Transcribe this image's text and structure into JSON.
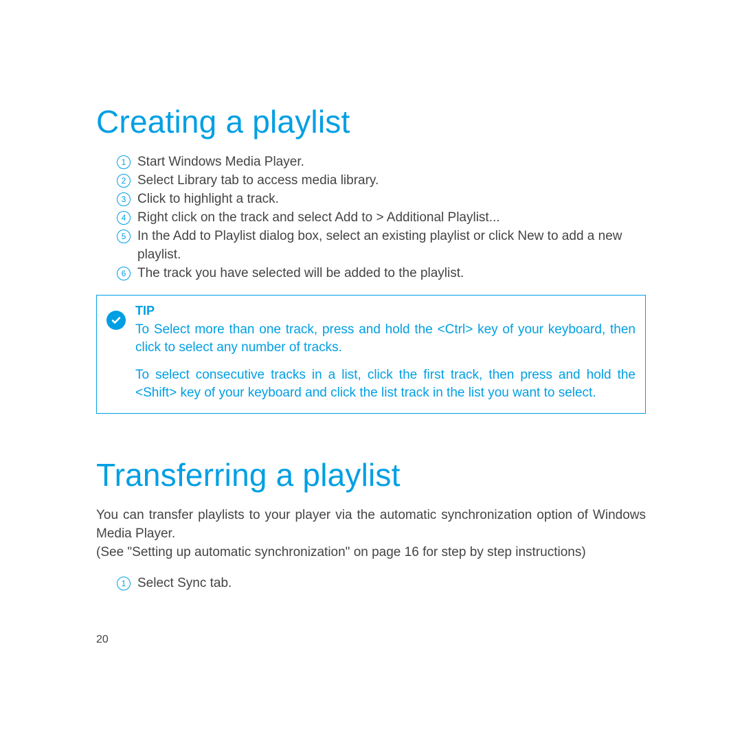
{
  "accent_color": "#009FE3",
  "section1": {
    "title": "Creating a playlist",
    "steps": [
      "Start Windows Media Player.",
      "Select Library tab to access media library.",
      "Click to highlight a track.",
      "Right click on the track and select Add to > Additional Playlist...",
      "In the Add to Playlist dialog box, select an existing playlist or click New to add a new playlist.",
      "The track you have selected will be added to the playlist."
    ],
    "tip": {
      "label": "TIP",
      "paragraphs": [
        "To Select more than one track, press and hold the <Ctrl> key of your keyboard, then click to select any number of tracks.",
        "To select consecutive tracks in a list, click the first track, then press and hold the <Shift> key of your keyboard and click the list track in the list you want to select."
      ]
    }
  },
  "section2": {
    "title": "Transferring a playlist",
    "intro_lines": [
      "You can transfer playlists to your player via the automatic synchronization option of Windows Media Player.",
      "(See \"Setting up automatic synchronization\" on page 16 for step by step instructions)"
    ],
    "steps": [
      "Select Sync tab."
    ]
  },
  "page_number": "20"
}
